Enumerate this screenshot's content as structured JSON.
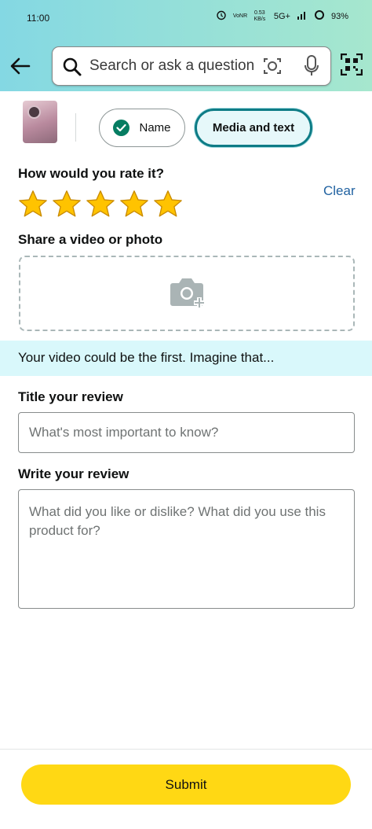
{
  "status_bar": {
    "time": "11:00",
    "net_small": "VoNR",
    "speed": "0.53 KB/s",
    "network": "5G+",
    "battery": "93%"
  },
  "header": {
    "search_placeholder": "Search or ask a question",
    "icons": [
      "back-arrow-icon",
      "search-icon",
      "camera-lens-icon",
      "mic-icon",
      "qr-scan-icon"
    ]
  },
  "steps": {
    "name_label": "Name",
    "media_label": "Media and text"
  },
  "rating": {
    "heading": "How would you rate it?",
    "clear_label": "Clear",
    "stars": 5,
    "max_stars": 5,
    "star_color": "#ffc300"
  },
  "media": {
    "heading": "Share a video or photo",
    "banner_text": "Your video could be the first. Imagine that..."
  },
  "title_review": {
    "heading": "Title your review",
    "placeholder": "What's most important to know?",
    "value": ""
  },
  "write_review": {
    "heading": "Write your review",
    "placeholder": "What did you like or dislike? What did you use this product for?",
    "value": ""
  },
  "footer": {
    "submit_label": "Submit"
  },
  "colors": {
    "accent_teal": "#0e7c86",
    "link_blue": "#2162a1",
    "submit_yellow": "#ffd814",
    "check_green": "#067d62"
  }
}
